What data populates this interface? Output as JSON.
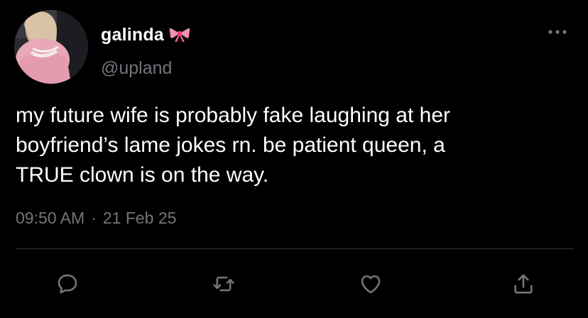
{
  "tweet": {
    "author": {
      "display_name": "galinda",
      "handle": "@upland",
      "avatar_icon": "profile-photo",
      "badge_icon": "pink-bow-emoji"
    },
    "text": "my future wife is probably fake laughing at her\nboyfriend’s lame jokes rn. be patient queen, a\nTRUE clown is on the way.",
    "time": "09:50 AM",
    "separator": "·",
    "date": "21 Feb 25",
    "actions": [
      {
        "name": "reply",
        "icon": "reply-icon"
      },
      {
        "name": "retweet",
        "icon": "retweet-icon"
      },
      {
        "name": "like",
        "icon": "heart-icon"
      },
      {
        "name": "share",
        "icon": "share-icon"
      }
    ]
  },
  "colors": {
    "background": "#000000",
    "primary_text": "#ffffff",
    "secondary_text": "#71767b",
    "divider": "#2f3336",
    "bow": "#f48fb1"
  }
}
